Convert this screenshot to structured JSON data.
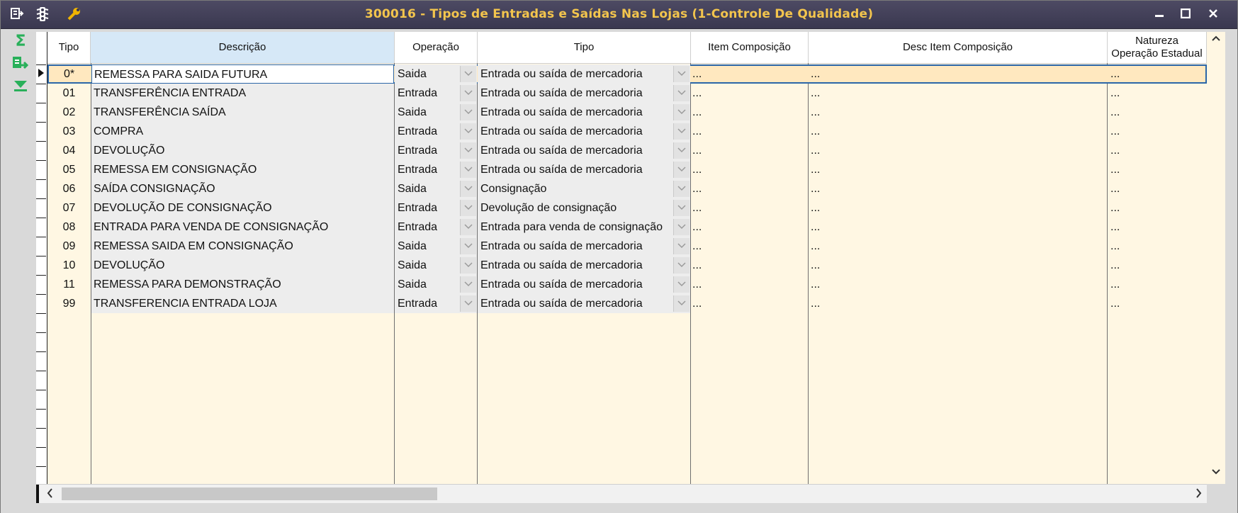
{
  "window": {
    "title": "300016 - Tipos de Entradas e Saídas Nas Lojas (1-Controle De Qualidade)",
    "icons": [
      "menu-export-icon",
      "traffic-light-icon",
      "wrench-icon"
    ],
    "controls": {
      "minimize": "—",
      "maximize": "□",
      "close": "✕"
    }
  },
  "toolbar": {
    "sum_symbol": "Σ",
    "export_symbol": "⇨",
    "expand_symbol": "⏬"
  },
  "columns": {
    "tipo": "Tipo",
    "descricao": "Descrição",
    "operacao": "Operação",
    "tipo2": "Tipo",
    "item_composicao": "Item Composição",
    "desc_item_composicao": "Desc Item Composição",
    "natureza_line1": "Natureza",
    "natureza_line2": "Operação Estadual"
  },
  "rows": [
    {
      "tipo": "0*",
      "descricao": "REMESSA PARA SAIDA FUTURA",
      "operacao": "Saida",
      "tipo2": "Entrada ou saída de mercadoria",
      "item": "...",
      "desc_item": "...",
      "natureza": "..."
    },
    {
      "tipo": "01",
      "descricao": "TRANSFERÊNCIA ENTRADA",
      "operacao": "Entrada",
      "tipo2": "Entrada ou saída de mercadoria",
      "item": "...",
      "desc_item": "...",
      "natureza": "..."
    },
    {
      "tipo": "02",
      "descricao": "TRANSFERÊNCIA SAÍDA",
      "operacao": "Saida",
      "tipo2": "Entrada ou saída de mercadoria",
      "item": "...",
      "desc_item": "...",
      "natureza": "..."
    },
    {
      "tipo": "03",
      "descricao": "COMPRA",
      "operacao": "Entrada",
      "tipo2": "Entrada ou saída de mercadoria",
      "item": "...",
      "desc_item": "...",
      "natureza": "..."
    },
    {
      "tipo": "04",
      "descricao": "DEVOLUÇÃO",
      "operacao": "Entrada",
      "tipo2": "Entrada ou saída de mercadoria",
      "item": "...",
      "desc_item": "...",
      "natureza": "..."
    },
    {
      "tipo": "05",
      "descricao": "REMESSA EM CONSIGNAÇÃO",
      "operacao": "Entrada",
      "tipo2": "Entrada ou saída de mercadoria",
      "item": "...",
      "desc_item": "...",
      "natureza": "..."
    },
    {
      "tipo": "06",
      "descricao": "SAÍDA CONSIGNAÇÃO",
      "operacao": "Saida",
      "tipo2": "Consignação",
      "item": "...",
      "desc_item": "...",
      "natureza": "..."
    },
    {
      "tipo": "07",
      "descricao": "DEVOLUÇÃO DE CONSIGNAÇÃO",
      "operacao": "Entrada",
      "tipo2": "Devolução de consignação",
      "item": "...",
      "desc_item": "...",
      "natureza": "..."
    },
    {
      "tipo": "08",
      "descricao": "ENTRADA PARA VENDA DE CONSIGNAÇÃO",
      "operacao": "Entrada",
      "tipo2": "Entrada para venda de consignação",
      "item": "...",
      "desc_item": "...",
      "natureza": "..."
    },
    {
      "tipo": "09",
      "descricao": "REMESSA SAIDA EM CONSIGNAÇÃO",
      "operacao": "Saida",
      "tipo2": "Entrada ou saída de mercadoria",
      "item": "...",
      "desc_item": "...",
      "natureza": "..."
    },
    {
      "tipo": "10",
      "descricao": "DEVOLUÇÃO",
      "operacao": "Saida",
      "tipo2": "Entrada ou saída de mercadoria",
      "item": "...",
      "desc_item": "...",
      "natureza": "..."
    },
    {
      "tipo": "11",
      "descricao": "REMESSA PARA DEMONSTRAÇÃO",
      "operacao": "Saida",
      "tipo2": "Entrada ou saída de mercadoria",
      "item": "...",
      "desc_item": "...",
      "natureza": "..."
    },
    {
      "tipo": "99",
      "descricao": "TRANSFERENCIA ENTRADA LOJA",
      "operacao": "Entrada",
      "tipo2": "Entrada ou saída de mercadoria",
      "item": "...",
      "desc_item": "...",
      "natureza": "..."
    }
  ],
  "dropdown_symbol": "﹀",
  "scroll": {
    "up": "⌃",
    "down": "⌄",
    "left": "‹",
    "right": "›"
  },
  "colors": {
    "title_text": "#f3c54d",
    "titlebar": "#3a3850",
    "grid_bg": "#fff7e3",
    "selection": "#2b66a8"
  }
}
